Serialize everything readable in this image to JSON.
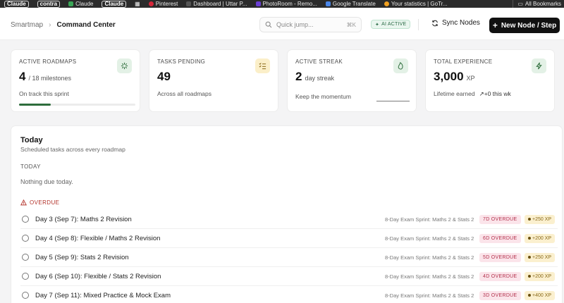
{
  "bookmarks": {
    "items": [
      "Claude",
      "contra",
      "Claude",
      "Claude",
      "Pinterest",
      "Dashboard | Uttar P...",
      "PhotoRoom - Remo...",
      "Google Translate",
      "Your statistics | GoTr..."
    ],
    "right": "All Bookmarks"
  },
  "header": {
    "breadcrumb_root": "Smartmap",
    "breadcrumb_current": "Command Center",
    "search_placeholder": "Quick jump...",
    "search_shortcut": "⌘K",
    "ai_badge": "AI ACTIVE",
    "sync_label": "Sync Nodes",
    "new_label": "New Node / Step"
  },
  "cards": {
    "roadmaps": {
      "label": "Active Roadmaps",
      "value": "4",
      "extra": "/ 18 milestones",
      "sub": "On track this sprint",
      "progress": 0.27,
      "icon": "sparkle-icon"
    },
    "tasks": {
      "label": "Tasks Pending",
      "value": "49",
      "sub": "Across all roadmaps",
      "icon": "checklist-icon"
    },
    "streak": {
      "label": "Active Streak",
      "value": "2",
      "extra": "day streak",
      "sub": "Keep the momentum",
      "icon": "flame-icon"
    },
    "xp": {
      "label": "Total Experience",
      "value": "3,000",
      "extra": "XP",
      "sub": "Lifetime earned",
      "trend": "+0 this wk",
      "icon": "bolt-icon"
    }
  },
  "today": {
    "title": "Today",
    "subtitle": "Scheduled tasks across every roadmap",
    "today_label": "TODAY",
    "empty": "Nothing due today.",
    "overdue_label": "OVERDUE",
    "tasks": [
      {
        "title": "Day 3 (Sep 7): Maths 2 Revision",
        "course": "8-Day Exam Sprint: Maths 2 & Stats 2",
        "overdue": "7D OVERDUE",
        "xp": "+250 XP"
      },
      {
        "title": "Day 4 (Sep 8): Flexible / Maths 2 Revision",
        "course": "8-Day Exam Sprint: Maths 2 & Stats 2",
        "overdue": "6D OVERDUE",
        "xp": "+200 XP"
      },
      {
        "title": "Day 5 (Sep 9): Stats 2 Revision",
        "course": "8-Day Exam Sprint: Maths 2 & Stats 2",
        "overdue": "5D OVERDUE",
        "xp": "+250 XP"
      },
      {
        "title": "Day 6 (Sep 10): Flexible / Stats 2 Revision",
        "course": "8-Day Exam Sprint: Maths 2 & Stats 2",
        "overdue": "4D OVERDUE",
        "xp": "+200 XP"
      },
      {
        "title": "Day 7 (Sep 11): Mixed Practice & Mock Exam",
        "course": "8-Day Exam Sprint: Maths 2 & Stats 2",
        "overdue": "3D OVERDUE",
        "xp": "+400 XP"
      }
    ]
  },
  "colors": {
    "accent_green": "#2e6d3c",
    "overdue_red": "#b3322a",
    "primary_button": "#111111"
  }
}
